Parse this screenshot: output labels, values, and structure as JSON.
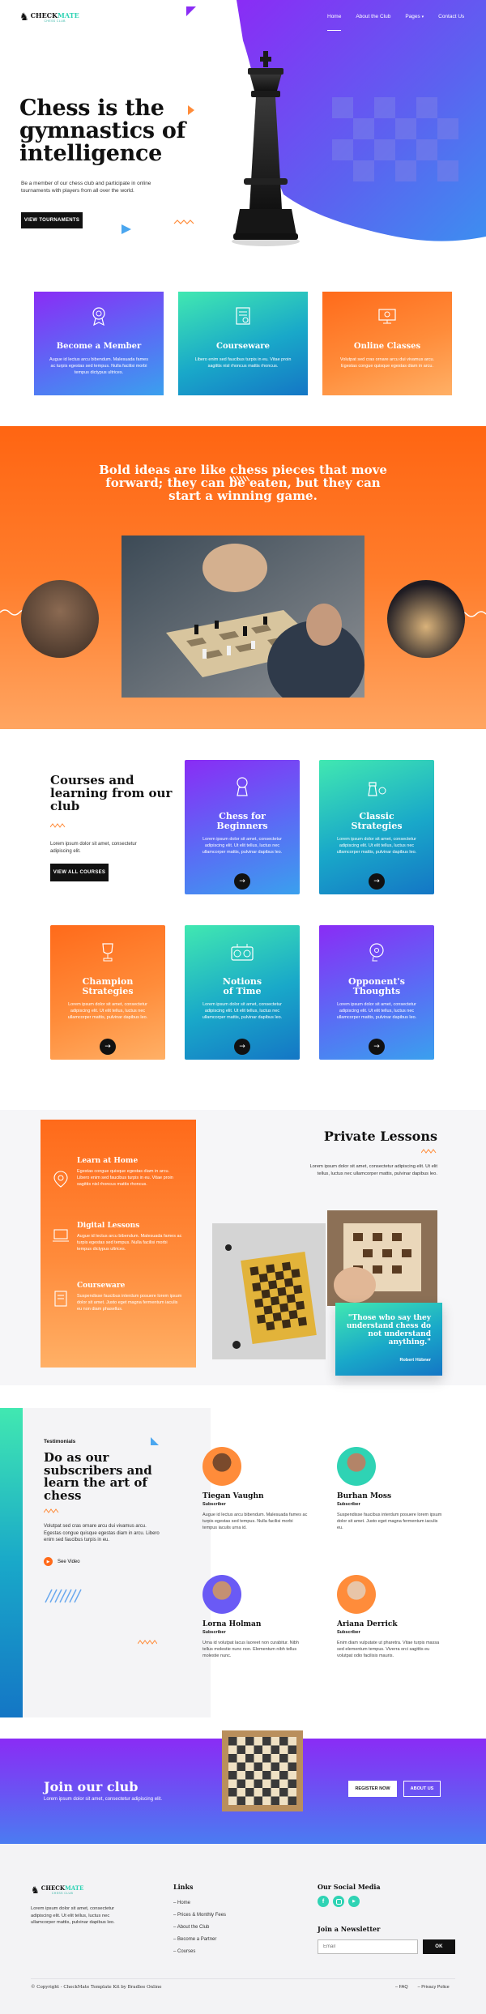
{
  "brand": {
    "name_a": "CHECK",
    "name_b": "MATE",
    "tagline": "CHESS CLUB"
  },
  "nav": {
    "items": [
      "Home",
      "About the Club",
      "Pages",
      "Contact Us"
    ]
  },
  "hero": {
    "title_l1": "Chess is the",
    "title_l2": "gymnastics of",
    "title_l3": "intelligence",
    "subtitle": "Be a member of our chess club and participate in online tournaments with players from all over the world.",
    "button": "VIEW TOURNAMENTS"
  },
  "features": [
    {
      "title": "Become a Member",
      "text": "Augue id lectus arcu bibendum. Malesuada fames ac turpis egestas sed tempus. Nulla facilisi morbi tempus dictypus ultrices."
    },
    {
      "title": "Courseware",
      "text": "Libero enim sed faucibus turpis in eu. Vitae proin sagittis nisl rhoncus mattis rhoncus."
    },
    {
      "title": "Online Classes",
      "text": "Volutpat sed cras ornare arcu dui vivamus arcu. Egestas congue quisque egestas diam in arcu."
    }
  ],
  "quote_band": {
    "text_l1": "Bold ideas are like chess pieces that move",
    "text_l2": "forward; they can be eaten, but they can",
    "text_l3": "start a winning game."
  },
  "courses": {
    "heading_l1": "Courses and",
    "heading_l2": "learning from our",
    "heading_l3": "club",
    "text": "Lorem ipsum dolor sit amet, consectetur adipiscing elit.",
    "button": "VIEW ALL COURSES",
    "items": [
      {
        "l1": "Chess for",
        "l2": "Beginners",
        "text": "Lorem ipsum dolor sit amet, consectetur adipiscing elit. Ut elit tellus, luctus nec ullamcorper mattis, pulvinar dapibus leo."
      },
      {
        "l1": "Classic",
        "l2": "Strategies",
        "text": "Lorem ipsum dolor sit amet, consectetur adipiscing elit. Ut elit tellus, luctus nec ullamcorper mattis, pulvinar dapibus leo."
      },
      {
        "l1": "Champion",
        "l2": "Strategies",
        "text": "Lorem ipsum dolor sit amet, consectetur adipiscing elit. Ut elit tellus, luctus nec ullamcorper mattis, pulvinar dapibus leo."
      },
      {
        "l1": "Notions",
        "l2": "of Time",
        "text": "Lorem ipsum dolor sit amet, consectetur adipiscing elit. Ut elit tellus, luctus nec ullamcorper mattis, pulvinar dapibus leo."
      },
      {
        "l1": "Opponent's",
        "l2": "Thoughts",
        "text": "Lorem ipsum dolor sit amet, consectetur adipiscing elit. Ut elit tellus, luctus nec ullamcorper mattis, pulvinar dapibus leo."
      }
    ]
  },
  "private": {
    "items": [
      {
        "title": "Learn at Home",
        "text": "Egestas congue quisque egestas diam in arcu. Libero enim sed faucibus turpis in eu. Vitae proin sagittis nisl rhoncus mattis rhoncus."
      },
      {
        "title": "Digital Lessons",
        "text": "Augue id lectus arcu bibendum. Malesuada fames ac turpis egestas sed tempus. Nulla facilisi morbi tempus dictypus ultrices."
      },
      {
        "title": "Courseware",
        "text": "Suspendisse faucibus interdum posuere lorem ipsum dolor sit amet. Justo eget magna fermentum iaculis eu non diam phasellus."
      }
    ],
    "heading": "Private Lessons",
    "text": "Lorem ipsum dolor sit amet, consectetur adipiscing elit. Ut elit tellus, luctus nec ullamcorper mattis, pulvinar dapibus leo.",
    "quote_l1": "\"Those who say they",
    "quote_l2": "understand chess do",
    "quote_l3": "not understand",
    "quote_l4": "anything.\"",
    "quote_author": "Robert Hübner"
  },
  "testimonials": {
    "label": "Testimonials",
    "heading_l1": "Do as our",
    "heading_l2": "subscribers and",
    "heading_l3": "learn the art of",
    "heading_l4": "chess",
    "text": "Volutpat sed cras ornare arcu dui vivamus arcu. Egestas congue quisque egestas diam in arcu. Libero enim sed faucibus turpis in eu.",
    "video": "See Video",
    "people": [
      {
        "name": "Tiegan Vaughn",
        "role": "Subscriber",
        "text": "Augue id lectus arcu bibendum. Malesuada fames ac turpis egestas sed tempus. Nulla facilisi morbi tempus iaculis urna id."
      },
      {
        "name": "Burhan Moss",
        "role": "Subscriber",
        "text": "Suspendisse faucibus interdum posuere lorem ipsum dolor sit amet. Justo eget magna fermentum iaculis eu."
      },
      {
        "name": "Lorna Holman",
        "role": "Subscriber",
        "text": "Urna id volutpat lacus laoreet non curabitur. Nibh tellus molestie nunc non. Elementum nibh tellus molestie nunc."
      },
      {
        "name": "Ariana Derrick",
        "role": "Subscriber",
        "text": "Enim diam vulputate ut pharetra. Vitae turpis massa sed elementum tempus. Viverra orci sagittis eu volutpat odio facilisis mauris."
      }
    ]
  },
  "club_band": {
    "heading": "Join our club",
    "text": "Lorem ipsum dolor sit amet, consectetur adipiscing elit.",
    "btn_register": "REGISTER NOW",
    "btn_about": "ABOUT US"
  },
  "footer": {
    "about": "Lorem ipsum dolor sit amet, consectetur adipiscing elit. Ut elit tellus, luctus nec ullamcorper mattis, pulvinar dapibus leo.",
    "links_title": "Links",
    "links": [
      "Home",
      "Prices & Monthly Fees",
      "About the Club",
      "Become a Partner",
      "Courses"
    ],
    "social_title": "Our Social Media",
    "newsletter_title": "Join a Newsletter",
    "email_placeholder": "Email",
    "ok": "OK",
    "copyright": "© Copyright - CheckMate Template Kit by Bradlee Online",
    "faq": "FAQ",
    "privacy": "Privacy Police"
  },
  "colors": {
    "purple": "#8a2cf5",
    "teal": "#2fd3b4",
    "orange": "#ff6a1a",
    "dark": "#111111"
  }
}
